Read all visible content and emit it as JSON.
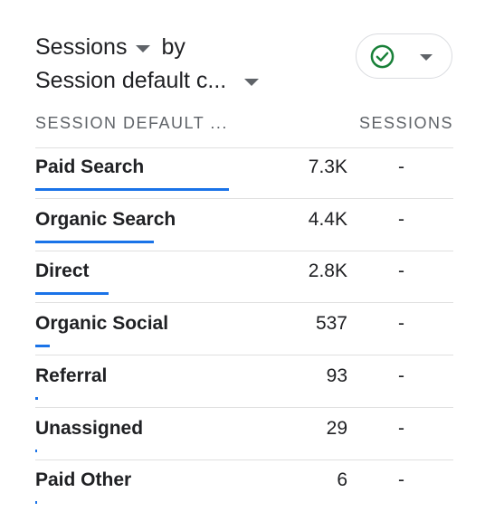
{
  "title": {
    "metric": "Sessions",
    "by": "by",
    "dimension": "Session default c..."
  },
  "compare_button": {
    "icon": "check-circle-icon",
    "status_color": "#188038"
  },
  "table": {
    "headers": {
      "dimension": "SESSION DEFAULT ...",
      "metric": "SESSIONS"
    },
    "rows": [
      {
        "name": "Paid Search",
        "value": "7.3K",
        "compare": "-",
        "share": 1.0
      },
      {
        "name": "Organic Search",
        "value": "4.4K",
        "compare": "-",
        "share": 0.61
      },
      {
        "name": "Direct",
        "value": "2.8K",
        "compare": "-",
        "share": 0.38
      },
      {
        "name": "Organic Social",
        "value": "537",
        "compare": "-",
        "share": 0.073
      },
      {
        "name": "Referral",
        "value": "93",
        "compare": "-",
        "share": 0.013
      },
      {
        "name": "Unassigned",
        "value": "29",
        "compare": "-",
        "share": 0.004
      },
      {
        "name": "Paid Other",
        "value": "6",
        "compare": "-",
        "share": 0.001
      }
    ]
  },
  "colors": {
    "accent": "#1a73e8",
    "text": "#202124",
    "muted": "#5f6368",
    "divider": "#e0e0e0"
  }
}
